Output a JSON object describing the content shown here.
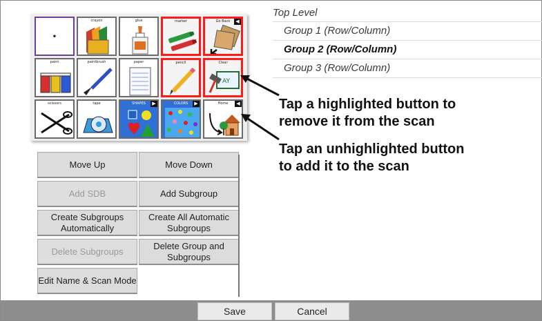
{
  "grid": {
    "cells": [
      {
        "label": "•"
      },
      {
        "label": "crayon"
      },
      {
        "label": "glue"
      },
      {
        "label": "marker"
      },
      {
        "label": "Go Back"
      },
      {
        "label": "paint"
      },
      {
        "label": "paintbrush"
      },
      {
        "label": "paper"
      },
      {
        "label": "pencil"
      },
      {
        "label": "Clear"
      },
      {
        "label": "scissors"
      },
      {
        "label": "tape"
      },
      {
        "label": "SHAPES"
      },
      {
        "label": "COLORS"
      },
      {
        "label": "Home"
      }
    ],
    "highlight_color": "#ff1a1a",
    "folder_color": "#2f6fd6"
  },
  "groups": {
    "top_level": "Top Level",
    "items": [
      {
        "label": "Group 1 (Row/Column)"
      },
      {
        "label": "Group 2 (Row/Column)"
      },
      {
        "label": "Group 3 (Row/Column)"
      }
    ],
    "selected_index": 1
  },
  "annotations": {
    "remove_line1": "Tap a highlighted button to",
    "remove_line2": "remove it from the scan",
    "add_line1": "Tap an unhighlighted button",
    "add_line2": "to add it to the scan"
  },
  "commands": {
    "move_up": "Move Up",
    "move_down": "Move Down",
    "add_sdb": "Add SDB",
    "add_subgroup": "Add Subgroup",
    "create_subgroups_auto": "Create Subgroups Automatically",
    "create_all_auto": "Create All Automatic Subgroups",
    "delete_subgroups": "Delete Subgroups",
    "delete_group_and_subgroups": "Delete Group and Subgroups",
    "edit_name_scan_mode": "Edit Name & Scan Mode"
  },
  "bottom_bar": {
    "save": "Save",
    "cancel": "Cancel"
  }
}
